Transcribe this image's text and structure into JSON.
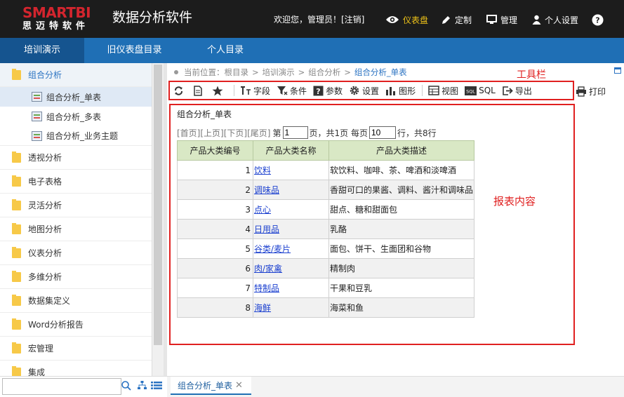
{
  "header": {
    "logo_text": "SMARTBI",
    "logo_sub": "思迈特软件",
    "app_title": "数据分析软件",
    "welcome": "欢迎您，管理员！[注销]",
    "nav": [
      {
        "label": "仪表盘",
        "icon": "eye-icon",
        "color": "#f0c419"
      },
      {
        "label": "定制",
        "icon": "pencil-icon"
      },
      {
        "label": "管理",
        "icon": "monitor-icon"
      },
      {
        "label": "个人设置",
        "icon": "user-icon"
      },
      {
        "label": "",
        "icon": "help-icon"
      }
    ]
  },
  "top_tabs": [
    "培训演示",
    "旧仪表盘目录",
    "个人目录"
  ],
  "sidebar": {
    "items": [
      {
        "label": "组合分析",
        "expanded": true
      },
      {
        "label": "透视分析"
      },
      {
        "label": "电子表格"
      },
      {
        "label": "灵活分析"
      },
      {
        "label": "地图分析"
      },
      {
        "label": "仪表分析"
      },
      {
        "label": "多维分析"
      },
      {
        "label": "数据集定义"
      },
      {
        "label": "Word分析报告"
      },
      {
        "label": "宏管理"
      },
      {
        "label": "集成"
      }
    ],
    "sub_items": [
      "组合分析_单表",
      "组合分析_多表",
      "组合分析_业务主题"
    ],
    "search_placeholder": ""
  },
  "breadcrumb": {
    "prefix": "当前位置：",
    "parts": [
      "根目录",
      "培训演示",
      "组合分析"
    ],
    "current": "组合分析_单表"
  },
  "toolbar": {
    "annotation": "工具栏",
    "buttons": [
      "字段",
      "条件",
      "参数",
      "设置",
      "图形",
      "视图",
      "SQL",
      "导出"
    ],
    "print": "打印"
  },
  "report": {
    "annotation": "报表内容",
    "title": "组合分析_单表",
    "pager": {
      "first": "[首页]",
      "prev": "[上页]",
      "next": "[下页]",
      "last": "[尾页]",
      "page_prefix": "第",
      "page_value": "1",
      "page_suffix": "页，共1页 每页",
      "rows_value": "10",
      "rows_suffix": "行，共8行"
    },
    "columns": [
      "产品大类编号",
      "产品大类名称",
      "产品大类描述"
    ],
    "rows": [
      [
        "1",
        "饮料",
        "软饮料、咖啡、茶、啤酒和淡啤酒"
      ],
      [
        "2",
        "调味品",
        "香甜可口的果酱、调料、酱汁和调味品"
      ],
      [
        "3",
        "点心",
        "甜点、糖和甜面包"
      ],
      [
        "4",
        "日用品",
        "乳酪"
      ],
      [
        "5",
        "谷类/麦片",
        "面包、饼干、生面团和谷物"
      ],
      [
        "6",
        "肉/家禽",
        "精制肉"
      ],
      [
        "7",
        "特制品",
        "干果和豆乳"
      ],
      [
        "8",
        "海鲜",
        "海菜和鱼"
      ]
    ]
  },
  "doc_tab": {
    "label": "组合分析_单表",
    "close": "✕"
  }
}
